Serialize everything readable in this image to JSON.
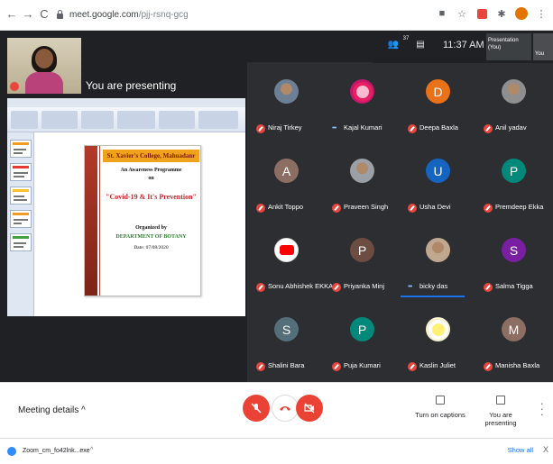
{
  "browser": {
    "url_host": "meet.google.com",
    "url_path": "/pjj-rsnq-gcg",
    "back_glyph": "←",
    "forward_glyph": "→",
    "reload_glyph": "C"
  },
  "meet": {
    "presenting_label": "You are presenting",
    "clock": "11:37 AM",
    "participants_count": "37",
    "presentation_tile_label": "Presentation (You)",
    "you_tile_label": "You"
  },
  "slide": {
    "college": "St. Xavier's College, Mahuadanr",
    "line1": "An Awareness Programme",
    "line2": "on",
    "topic": "\"Covid-19 & It's Prevention\"",
    "organized": "Organized by",
    "department": "DEPARTMENT OF BOTANY",
    "date": "Date: 07/08/2020"
  },
  "participants": [
    {
      "name": "Niraj Tirkey",
      "initial": "",
      "color": "#6d7f95",
      "kind": "photo"
    },
    {
      "name": "Kajal Kumari",
      "initial": "",
      "color": "#c2186b",
      "kind": "flower",
      "dots": true
    },
    {
      "name": "Deepa Baxla",
      "initial": "D",
      "color": "#e8711a"
    },
    {
      "name": "Anil yadav",
      "initial": "",
      "color": "#8f8f8f",
      "kind": "photo"
    },
    {
      "name": "Ankit Toppo",
      "initial": "A",
      "color": "#8d6e63"
    },
    {
      "name": "Praveen Singh",
      "initial": "",
      "color": "#9aa0a6",
      "kind": "photo"
    },
    {
      "name": "Usha Devi",
      "initial": "U",
      "color": "#1565c0"
    },
    {
      "name": "Premdeep Ekka",
      "initial": "P",
      "color": "#00897b"
    },
    {
      "name": "Sonu Abhishek EKKA",
      "initial": "",
      "color": "#ffffff",
      "kind": "youtube"
    },
    {
      "name": "Priyanka Minj",
      "initial": "P",
      "color": "#6d4c41"
    },
    {
      "name": "bicky das",
      "initial": "",
      "color": "#c0a890",
      "kind": "photo",
      "dots": true,
      "speaking": true
    },
    {
      "name": "Salma Tigga",
      "initial": "S",
      "color": "#7b1fa2"
    },
    {
      "name": "Shalini Bara",
      "initial": "S",
      "color": "#546e7a"
    },
    {
      "name": "Puja Kumari",
      "initial": "P",
      "color": "#00897b"
    },
    {
      "name": "Kaslin Juliet",
      "initial": "",
      "color": "#f5f0d0",
      "kind": "flower2"
    },
    {
      "name": "Manisha Baxla",
      "initial": "M",
      "color": "#8d6e63"
    }
  ],
  "controls": {
    "meeting_details": "Meeting details",
    "captions_label": "Turn on captions",
    "presenting_label": "You are presenting",
    "mic_color": "#ea4335",
    "end_color": "#ea4335"
  },
  "downloads": {
    "file_name": "Zoom_cm_fo42lnk...exe",
    "show_all": "Show all",
    "close": "X"
  }
}
